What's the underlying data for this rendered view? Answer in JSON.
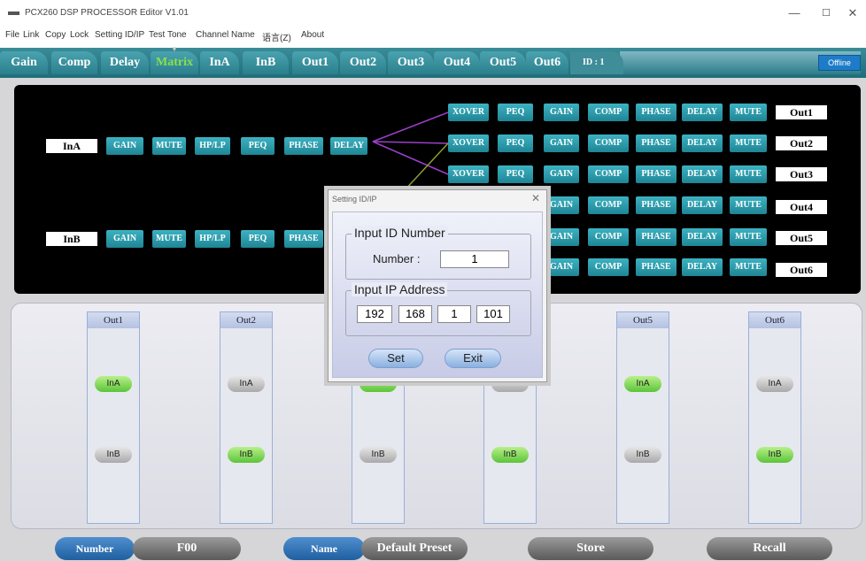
{
  "window": {
    "title": "PCX260 DSP PROCESSOR Editor V1.01",
    "min": "—",
    "max": "☐",
    "close": "✕"
  },
  "menu": [
    "File",
    "Link",
    "Copy",
    "Lock",
    "Setting ID/IP",
    "Test Tone",
    "Channel Name",
    "语言(Z)",
    "About"
  ],
  "tabs": [
    "Gain",
    "Comp",
    "Delay",
    "Matrix",
    "InA",
    "InB",
    "Out1",
    "Out2",
    "Out3",
    "Out4",
    "Out5",
    "Out6"
  ],
  "active_tab": "Matrix",
  "id_label": "ID : 1",
  "status": "Offline",
  "inputs": {
    "labels": [
      "InA",
      "InB"
    ],
    "blocks": [
      "GAIN",
      "MUTE",
      "HP/LP",
      "PEQ",
      "PHASE",
      "DELAY"
    ]
  },
  "outputs": {
    "blocks": [
      "XOVER",
      "PEQ",
      "GAIN",
      "COMP",
      "PHASE",
      "DELAY",
      "MUTE"
    ],
    "labels": [
      "Out1",
      "Out2",
      "Out3",
      "Out4",
      "Out5",
      "Out6"
    ]
  },
  "routing": [
    {
      "name": "Out1",
      "ina": "InA",
      "inb": "InB",
      "ina_on": true,
      "inb_on": false
    },
    {
      "name": "Out2",
      "ina": "InA",
      "inb": "InB",
      "ina_on": false,
      "inb_on": true
    },
    {
      "name": "",
      "ina": "InA",
      "inb": "InB",
      "ina_on": true,
      "inb_on": false
    },
    {
      "name": "",
      "ina": "InA",
      "inb": "InB",
      "ina_on": false,
      "inb_on": true
    },
    {
      "name": "Out5",
      "ina": "InA",
      "inb": "InB",
      "ina_on": true,
      "inb_on": false
    },
    {
      "name": "Out6",
      "ina": "InA",
      "inb": "InB",
      "ina_on": false,
      "inb_on": true
    }
  ],
  "bottom": {
    "number_label": "Number",
    "number_value": "F00",
    "name_label": "Name",
    "name_value": "Default Preset",
    "store": "Store",
    "recall": "Recall"
  },
  "dialog": {
    "title": "Setting ID/IP",
    "close": "✕",
    "id_group": "Input ID Number",
    "number_label": "Number :",
    "number_value": "1",
    "ip_group": "Input IP Address",
    "ip": [
      "192",
      "168",
      "1",
      "101"
    ],
    "set": "Set",
    "exit": "Exit"
  },
  "colors": {
    "tab_active": "#8be04a",
    "block": "#1f8595",
    "route_on": "#5cc43a",
    "offline": "#1e7bc7"
  }
}
